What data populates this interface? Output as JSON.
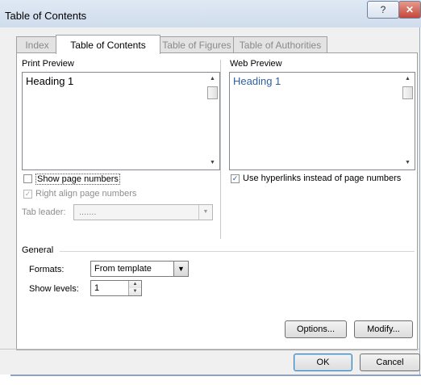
{
  "window": {
    "title": "Table of Contents",
    "help_glyph": "?",
    "close_glyph": "✕"
  },
  "tabs": [
    {
      "label": "Index",
      "active": false
    },
    {
      "label": "Table of Contents",
      "active": true
    },
    {
      "label": "Table of Figures",
      "active": false
    },
    {
      "label": "Table of Authorities",
      "active": false
    }
  ],
  "print_preview": {
    "label": "Print Preview",
    "sample_text": "Heading 1",
    "show_page_numbers": {
      "label": "Show page numbers",
      "checked": false
    },
    "right_align": {
      "label": "Right align page numbers",
      "checked": true,
      "disabled": true
    },
    "tab_leader": {
      "label": "Tab leader:",
      "value": ".......",
      "disabled": true
    }
  },
  "web_preview": {
    "label": "Web Preview",
    "sample_text": "Heading 1",
    "link_color": "#2e5f9f",
    "use_hyperlinks": {
      "label": "Use hyperlinks instead of page numbers",
      "checked": true
    }
  },
  "general": {
    "label": "General",
    "formats": {
      "label": "Formats:",
      "value": "From template"
    },
    "show_levels": {
      "label": "Show levels:",
      "value": "1"
    }
  },
  "buttons": {
    "options": "Options...",
    "modify": "Modify...",
    "ok": "OK",
    "cancel": "Cancel"
  },
  "glyphs": {
    "check": "✓",
    "up": "▲",
    "down": "▼"
  }
}
